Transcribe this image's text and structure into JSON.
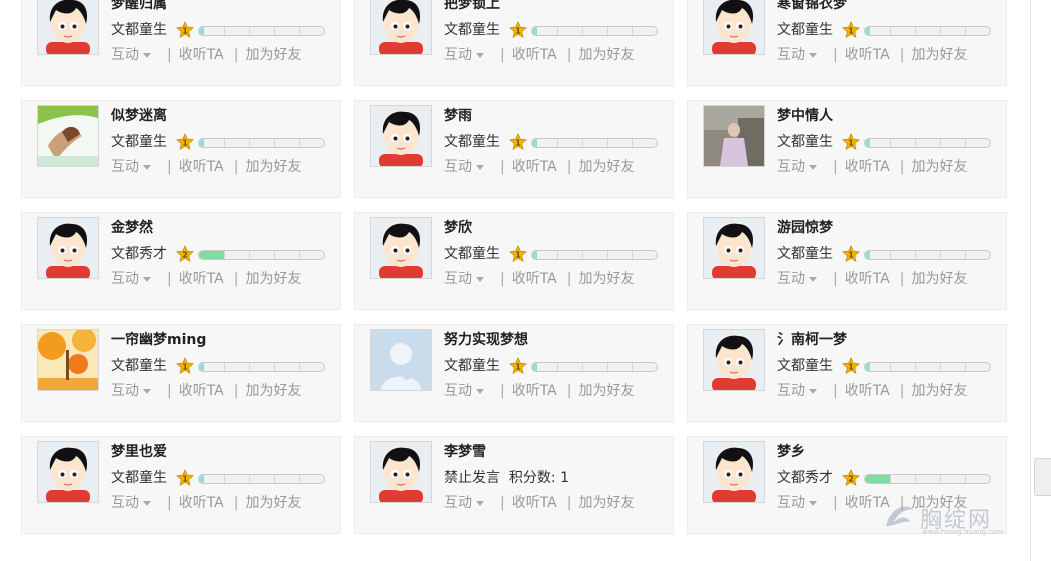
{
  "actions": {
    "interact": "互动",
    "listen": "收听TA",
    "add_friend": "加为好友"
  },
  "colors": {
    "bar_level1": "#9ad8d8",
    "bar_level2": "#7fdca0",
    "badge_gold": "#f2b600"
  },
  "users": [
    {
      "name": "梦醒归属",
      "rank": "文都童生",
      "level": "1",
      "progress": 0.04,
      "avatar": "boy"
    },
    {
      "name": "把梦锁上",
      "rank": "文都童生",
      "level": "1",
      "progress": 0.04,
      "avatar": "boy"
    },
    {
      "name": "寒窗锦衣梦",
      "rank": "文都童生",
      "level": "1",
      "progress": 0.04,
      "avatar": "boy"
    },
    {
      "name": "似梦迷离",
      "rank": "文都童生",
      "level": "1",
      "progress": 0.04,
      "avatar": "fairy"
    },
    {
      "name": "梦雨",
      "rank": "文都童生",
      "level": "1",
      "progress": 0.04,
      "avatar": "boy"
    },
    {
      "name": "梦中情人",
      "rank": "文都童生",
      "level": "1",
      "progress": 0.04,
      "avatar": "photo"
    },
    {
      "name": "金梦然",
      "rank": "文都秀才",
      "level": "2",
      "progress": 0.2,
      "avatar": "boy"
    },
    {
      "name": "梦欣",
      "rank": "文都童生",
      "level": "1",
      "progress": 0.04,
      "avatar": "boy"
    },
    {
      "name": "游园惊梦",
      "rank": "文都童生",
      "level": "1",
      "progress": 0.04,
      "avatar": "boy"
    },
    {
      "name": "一帘幽梦ming",
      "rank": "文都童生",
      "level": "1",
      "progress": 0.04,
      "avatar": "autumn"
    },
    {
      "name": "努力实现梦想",
      "rank": "文都童生",
      "level": "1",
      "progress": 0.04,
      "avatar": "default"
    },
    {
      "name": "氵南柯一梦",
      "rank": "文都童生",
      "level": "1",
      "progress": 0.04,
      "avatar": "boy"
    },
    {
      "name": "梦里也爱",
      "rank": "文都童生",
      "level": "1",
      "progress": 0.04,
      "avatar": "boy"
    },
    {
      "name": "李梦雪",
      "status": "禁止发言",
      "score_label": "积分数:",
      "score": "1",
      "avatar": "boy"
    },
    {
      "name": "梦乡",
      "rank": "文都秀才",
      "level": "2",
      "progress": 0.2,
      "avatar": "boy"
    }
  ],
  "watermark": {
    "text": "胸绽网",
    "url": "www.hxsng.huang.com"
  }
}
